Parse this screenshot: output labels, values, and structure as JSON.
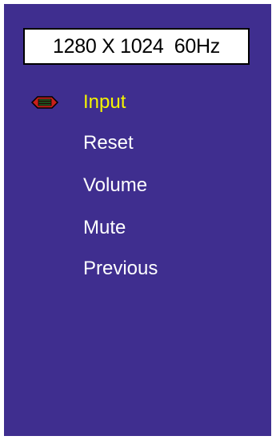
{
  "osd": {
    "resolution_text": "1280 X 1024  60Hz",
    "menu": {
      "selected_index": 0,
      "items": [
        {
          "label": "Input"
        },
        {
          "label": "Reset"
        },
        {
          "label": "Volume"
        },
        {
          "label": "Mute"
        },
        {
          "label": "Previous"
        }
      ]
    }
  },
  "colors": {
    "background": "#3f2e8f",
    "text": "#ffffff",
    "selected_text": "#f4f400",
    "selector_icon": "#c8201a"
  },
  "icons": {
    "selector": "selector-arrow-icon"
  }
}
